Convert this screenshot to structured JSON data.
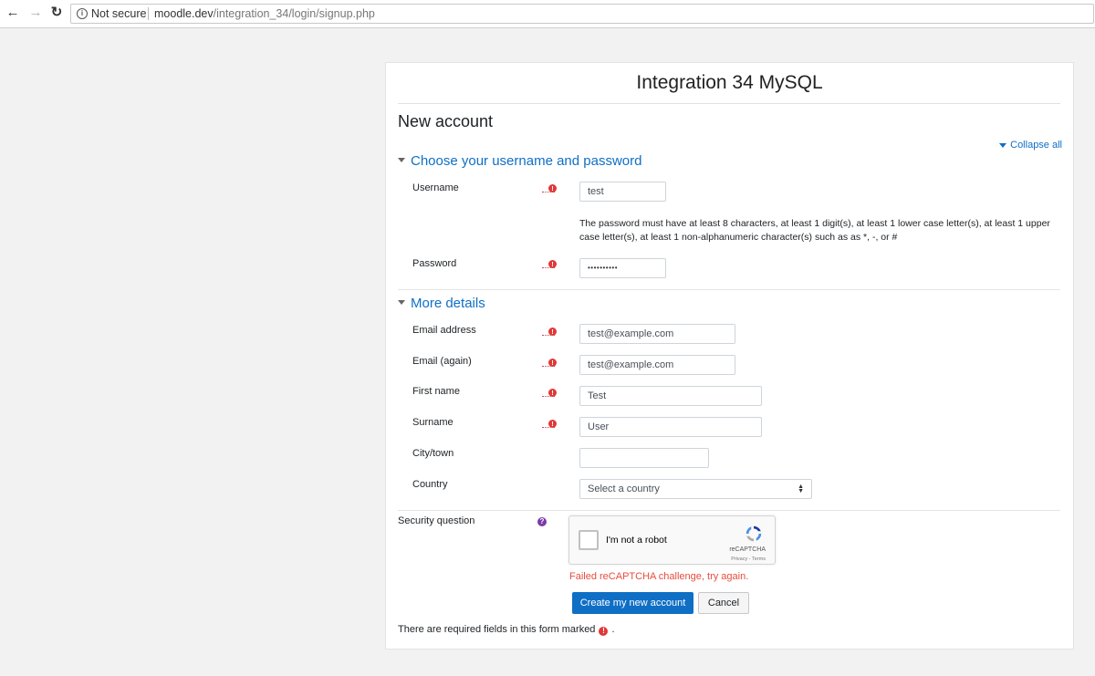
{
  "browser": {
    "back_icon": "←",
    "forward_icon": "→",
    "reload_icon": "↻",
    "security_label": "Not secure",
    "url_host": "moodle.dev",
    "url_path": "/integration_34/login/signup.php"
  },
  "site_title": "Integration 34 MySQL",
  "page_heading": "New account",
  "collapse_all": "Collapse all",
  "sections": {
    "username_password": "Choose your username and password",
    "more_details": "More details"
  },
  "fields": {
    "username": {
      "label": "Username",
      "value": "test"
    },
    "password_note": "The password must have at least 8 characters, at least 1 digit(s), at least 1 lower case letter(s), at least 1 upper case letter(s), at least 1 non-alphanumeric character(s) such as as *, -, or #",
    "password": {
      "label": "Password",
      "value": "••••••••••"
    },
    "email": {
      "label": "Email address",
      "value": "test@example.com"
    },
    "email_again": {
      "label": "Email (again)",
      "value": "test@example.com"
    },
    "first_name": {
      "label": "First name",
      "value": "Test"
    },
    "surname": {
      "label": "Surname",
      "value": "User"
    },
    "city": {
      "label": "City/town",
      "value": ""
    },
    "country": {
      "label": "Country",
      "value": "Select a country"
    }
  },
  "security": {
    "label": "Security question",
    "checkbox_label": "I'm not a robot",
    "brand": "reCAPTCHA",
    "terms": "Privacy - Terms",
    "error": "Failed reCAPTCHA challenge, try again."
  },
  "buttons": {
    "submit": "Create my new account",
    "cancel": "Cancel"
  },
  "required_note_before": "There are required fields in this form marked",
  "required_note_after": ".",
  "required_icon": "!",
  "help_icon": "?",
  "colors": {
    "link": "#0f6fc5",
    "required": "#e03838",
    "error": "#e74c3c",
    "primary_button": "#0f6fc5"
  }
}
